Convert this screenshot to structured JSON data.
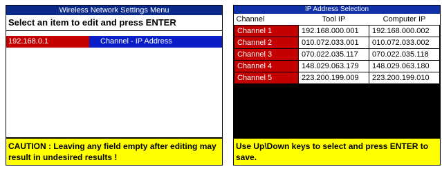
{
  "left_panel": {
    "title": "Wireless Network Settings Menu",
    "instruction": "Select an item to edit and press ENTER",
    "selected_item": {
      "ip": "192.168.0.1",
      "label": "Channel - IP Address"
    },
    "caution": "CAUTION : Leaving any field empty after editing may result in undesired results !"
  },
  "right_panel": {
    "title": "IP Address Selection",
    "columns": [
      "Channel",
      "Tool IP",
      "Computer IP"
    ],
    "rows": [
      {
        "channel": "Channel 1",
        "tool_ip": "192.168.000.001",
        "computer_ip": "192.168.000.002"
      },
      {
        "channel": "Channel 2",
        "tool_ip": "010.072.033.001",
        "computer_ip": "010.072.033.002"
      },
      {
        "channel": "Channel 3",
        "tool_ip": "070.022.035.117",
        "computer_ip": "070.022.035.118"
      },
      {
        "channel": "Channel 4",
        "tool_ip": "148.029.063.179",
        "computer_ip": "148.029.063.180"
      },
      {
        "channel": "Channel 5",
        "tool_ip": "223.200.199.009",
        "computer_ip": "223.200.199.010"
      }
    ],
    "help": "Use Up\\Down keys to select and press ENTER to save."
  },
  "colors": {
    "title_bar": "#0a2a8a",
    "selection_red": "#c40000",
    "selection_blue": "#0a1ec8",
    "caution_yellow": "#ffff00"
  }
}
